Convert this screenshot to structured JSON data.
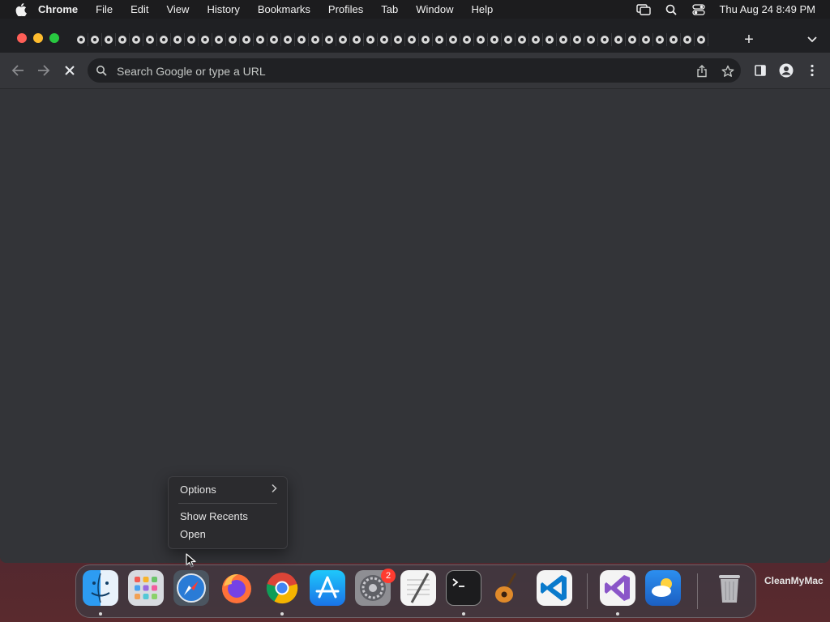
{
  "menubar": {
    "app_name": "Chrome",
    "items": [
      "File",
      "Edit",
      "View",
      "History",
      "Bookmarks",
      "Profiles",
      "Tab",
      "Window",
      "Help"
    ],
    "clock": "Thu Aug 24  8:49 PM",
    "icons": [
      "apple-icon",
      "screen-mirroring-icon",
      "spotlight-icon",
      "control-center-icon"
    ]
  },
  "browser": {
    "omnibox_placeholder": "Search Google or type a URL",
    "tab_count": 46,
    "new_tab_label": "+"
  },
  "context_menu": {
    "items": [
      {
        "label": "Options",
        "submenu": true
      },
      {
        "label": "Show Recents",
        "submenu": false
      },
      {
        "label": "Open",
        "submenu": false
      }
    ]
  },
  "dock": {
    "apps": [
      "Finder",
      "Launchpad",
      "Safari",
      "Firefox",
      "Google Chrome",
      "App Store",
      "System Settings",
      "TextEdit",
      "Terminal",
      "GarageBand",
      "Visual Studio Code",
      "Visual Studio",
      "CleanMyMac",
      "Trash"
    ],
    "system_settings_badge": "2",
    "partial_label": "CleanMyMac"
  },
  "colors": {
    "window_bg": "#333438",
    "tabstrip_bg": "#1f2023",
    "menu_bg": "#1c1c1e",
    "close": "#fe5f57",
    "minimize": "#febc2e",
    "zoom": "#28c840"
  }
}
